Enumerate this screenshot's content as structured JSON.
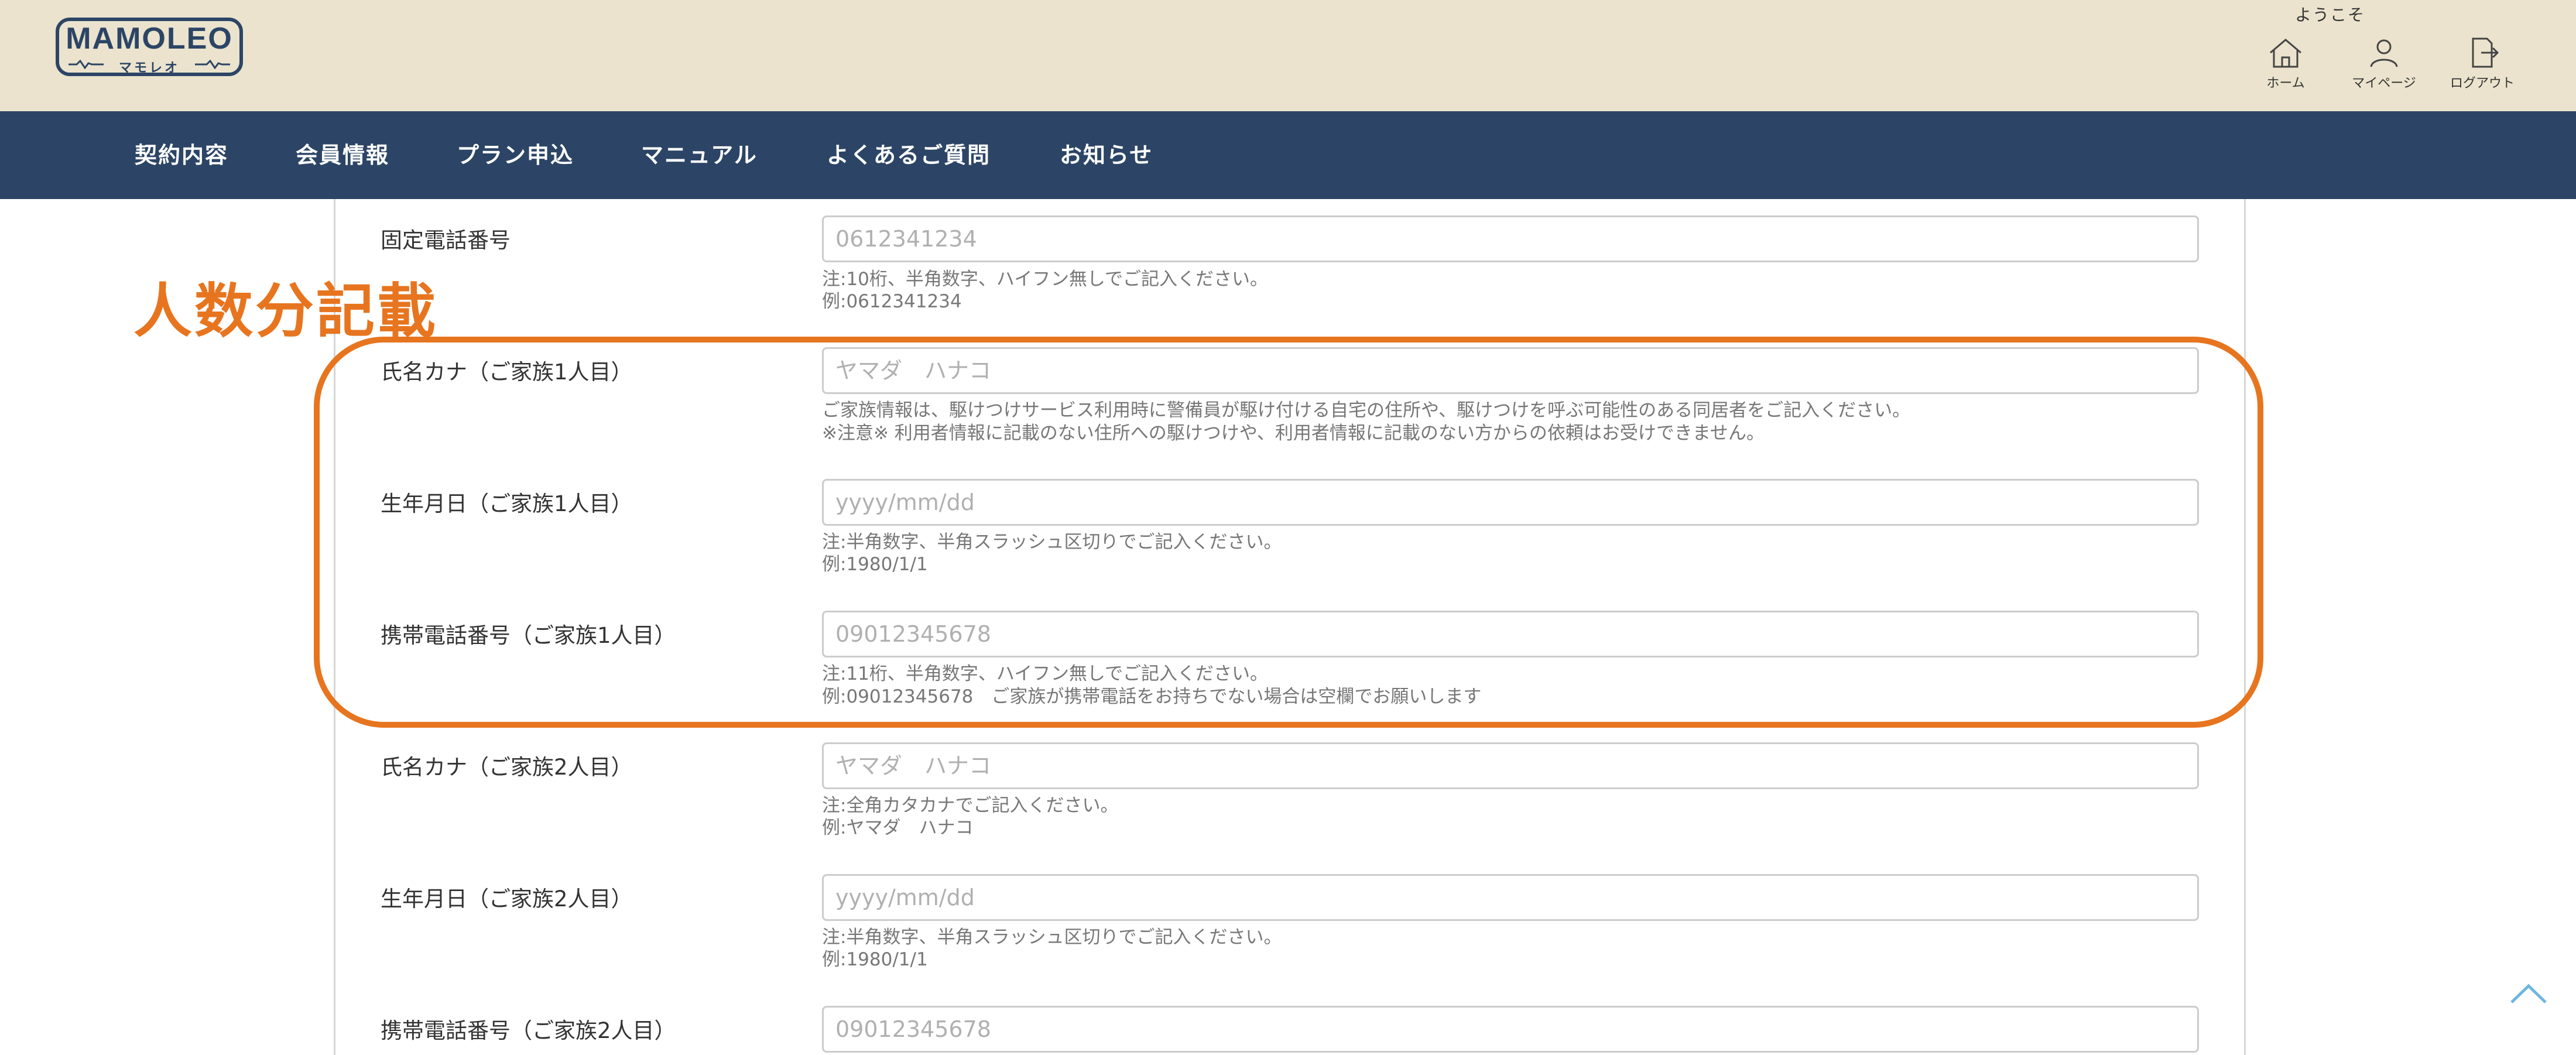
{
  "header": {
    "logo_text": "MAMOLEO",
    "logo_sub": "マモレオ",
    "welcome": "ようこそ",
    "nav": [
      {
        "label": "ホーム",
        "icon": "home-icon"
      },
      {
        "label": "マイページ",
        "icon": "user-icon"
      },
      {
        "label": "ログアウト",
        "icon": "logout-icon"
      }
    ]
  },
  "menu": [
    {
      "label": "契約内容"
    },
    {
      "label": "会員情報"
    },
    {
      "label": "プラン申込"
    },
    {
      "label": "マニュアル"
    },
    {
      "label": "よくあるご質問"
    },
    {
      "label": "お知らせ"
    }
  ],
  "annotation": {
    "title": "人数分記載",
    "color": "#e7751f"
  },
  "form": {
    "landline": {
      "label": "固定電話番号",
      "placeholder": "0612341234",
      "note1": "注:10桁、半角数字、ハイフン無しでご記入ください。",
      "note2": "例:0612341234"
    },
    "family1": {
      "kana": {
        "label": "氏名カナ（ご家族1人目）",
        "placeholder": "ヤマダ　ハナコ",
        "note1": "ご家族情報は、駆けつけサービス利用時に警備員が駆け付ける自宅の住所や、駆けつけを呼ぶ可能性のある同居者をご記入ください。",
        "note2": "※注意※ 利用者情報に記載のない住所への駆けつけや、利用者情報に記載のない方からの依頼はお受けできません。"
      },
      "birthday": {
        "label": "生年月日（ご家族1人目）",
        "placeholder": "yyyy/mm/dd",
        "note1": "注:半角数字、半角スラッシュ区切りでご記入ください。",
        "note2": "例:1980/1/1"
      },
      "mobile": {
        "label": "携帯電話番号（ご家族1人目）",
        "placeholder": "09012345678",
        "note1": "注:11桁、半角数字、ハイフン無しでご記入ください。",
        "note2": "例:09012345678　ご家族が携帯電話をお持ちでない場合は空欄でお願いします"
      }
    },
    "family2": {
      "kana": {
        "label": "氏名カナ（ご家族2人目）",
        "placeholder": "ヤマダ　ハナコ",
        "note1": "注:全角カタカナでご記入ください。",
        "note2": "例:ヤマダ　ハナコ"
      },
      "birthday": {
        "label": "生年月日（ご家族2人目）",
        "placeholder": "yyyy/mm/dd",
        "note1": "注:半角数字、半角スラッシュ区切りでご記入ください。",
        "note2": "例:1980/1/1"
      },
      "mobile": {
        "label": "携帯電話番号（ご家族2人目）",
        "placeholder": "09012345678"
      }
    }
  },
  "colors": {
    "header_bg": "#ebe3cd",
    "nav_bg": "#2c4566",
    "accent": "#e7751f"
  }
}
